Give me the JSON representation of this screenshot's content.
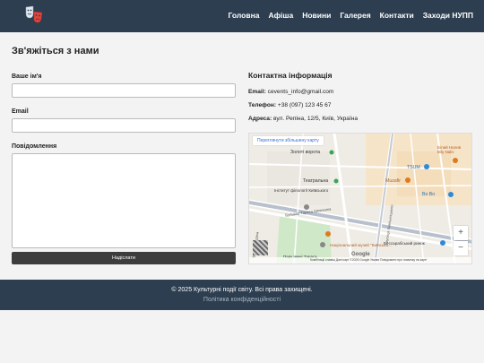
{
  "header": {
    "nav": [
      {
        "label": "Головна"
      },
      {
        "label": "Афіша"
      },
      {
        "label": "Новини"
      },
      {
        "label": "Галерея"
      },
      {
        "label": "Контакти"
      },
      {
        "label": "Заходи НУПП"
      }
    ],
    "logo_icon": "theater-masks-icon"
  },
  "main": {
    "title": "Зв'яжіться з нами",
    "form": {
      "name_label": "Ваше ім'я",
      "name_value": "",
      "email_label": "Email",
      "email_value": "",
      "message_label": "Повідомлення",
      "message_value": "",
      "submit_label": "Надіслати"
    },
    "contact": {
      "title": "Контактна інформація",
      "email_label": "Email:",
      "email_value": "cevents_info@gmail.com",
      "phone_label": "Телефон:",
      "phone_value": "+38 (097) 123 45 67",
      "address_label": "Адреса:",
      "address_value": "вул. Репіна, 12/5, Київ, Україна"
    },
    "map": {
      "larger_map_label": "Переглянути збільшену карту",
      "labels": [
        "Золоті ворота",
        "Театральна",
        "Інститут філології Київського",
        "Бульвар Тараса Шевченка",
        "Національний музей \"Київська...",
        "Бессарабський ринок",
        "TSUM",
        "Muzafir",
        "Bo Bo",
        "Білий Налив Bily Naliv",
        "Парк імені Тараса",
        "вулиця Хмельницького",
        "Вулиця Богдана"
      ],
      "attribution": "Комбінації клавіш   Дані карт ©2025 Google   Умови   Повідомити про помилку на карті",
      "google": "Google",
      "zoom_in": "+",
      "zoom_out": "−"
    }
  },
  "footer": {
    "copyright": "© 2025 Культурні події світу. Всі права захищені.",
    "privacy": "Політика конфіденційності"
  },
  "colors": {
    "header_bg": "#2c3e50",
    "footer_bg": "#2c3e50",
    "button_bg": "#3d3d3d"
  }
}
